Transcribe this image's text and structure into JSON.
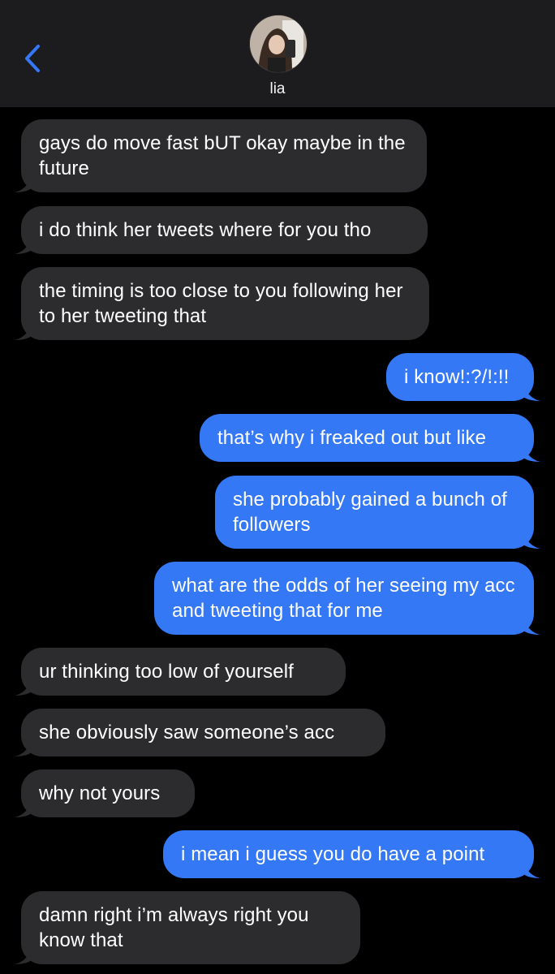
{
  "header": {
    "contact_name": "lia",
    "back_icon": "chevron-left-icon",
    "accent_color": "#3478f6"
  },
  "colors": {
    "incoming_bubble": "#2c2c2e",
    "outgoing_bubble": "#3478f6",
    "background": "#000000",
    "header_background": "#1c1c1e"
  },
  "messages": [
    {
      "direction": "incoming",
      "text": "gays do move fast bUT okay maybe in the future"
    },
    {
      "direction": "incoming",
      "text": "i do think her tweets where for you tho"
    },
    {
      "direction": "incoming",
      "text": "the timing is too close to you following her to her tweeting that"
    },
    {
      "direction": "outgoing",
      "text": "i know!:?/!:!!"
    },
    {
      "direction": "outgoing",
      "text": "that’s why i freaked out but like"
    },
    {
      "direction": "outgoing",
      "text": "she probably gained a bunch of followers"
    },
    {
      "direction": "outgoing",
      "text": "what are the odds of her seeing my acc and tweeting that for me"
    },
    {
      "direction": "incoming",
      "text": "ur thinking too low of yourself"
    },
    {
      "direction": "incoming",
      "text": "she obviously saw someone’s acc"
    },
    {
      "direction": "incoming",
      "text": "why not yours"
    },
    {
      "direction": "outgoing",
      "text": "i mean i guess you do have a point"
    },
    {
      "direction": "incoming",
      "text": "damn right i’m always right you know that"
    }
  ]
}
